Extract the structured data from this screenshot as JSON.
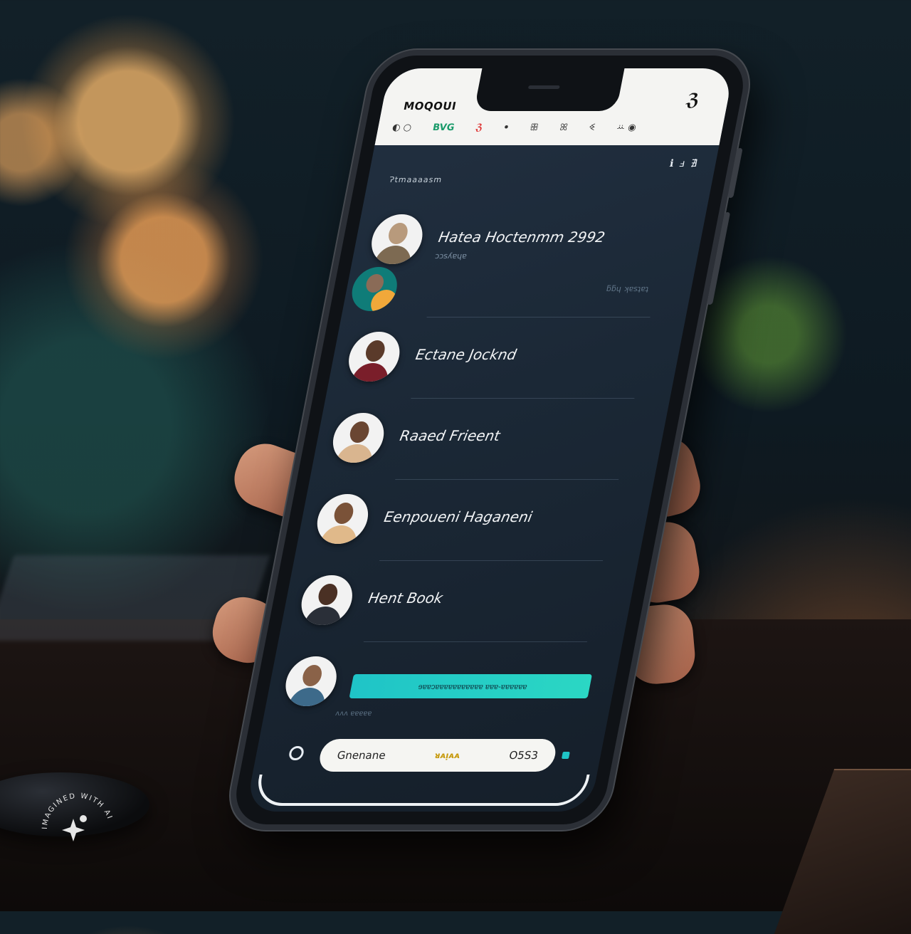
{
  "app": {
    "title": "MOQOUI",
    "logo_text": "ℨ"
  },
  "toolbar_chips": [
    "◐ ○",
    "BVG",
    "ℨ",
    "ꔷ",
    "ꕥ",
    "ꕤ",
    "ꔽ",
    "ꕁ ◉"
  ],
  "status_text": "ℹ ⅎ ∄",
  "section_header": "Ɂtmaaaasm",
  "contacts": [
    {
      "name": "Hatea Hoctenmm 2992",
      "sub": "ɔɔsʎɐɥɐ",
      "sub2": "ƃƃɥ ʞɐsʇɐʇ"
    },
    {
      "name": "Ectane Jocknd"
    },
    {
      "name": "Raaed Frieent"
    },
    {
      "name": "Eenpoueni Haganeni"
    },
    {
      "name": "Hent Book"
    },
    {
      "name": "",
      "cta_label": "ɘɐɐɔɐɐɐɐɐɐɐɐɐɐɐ  ɐɐɐ-ɐɐɐɐɐɐ",
      "cta_sub": "ʌʌʌ ɐɐɐɐɐ"
    }
  ],
  "bottom_bar": {
    "left_label": "Gnenane",
    "mid_label": "ᴚᴀᴉᴀᴀ",
    "right_label": "O5S3"
  },
  "watermark": {
    "text": "IMAGINED WITH AI"
  },
  "colors": {
    "accent": "#1fc4c7",
    "screen_bg": "#1b2836",
    "topbar_bg": "#f4f4f2"
  }
}
